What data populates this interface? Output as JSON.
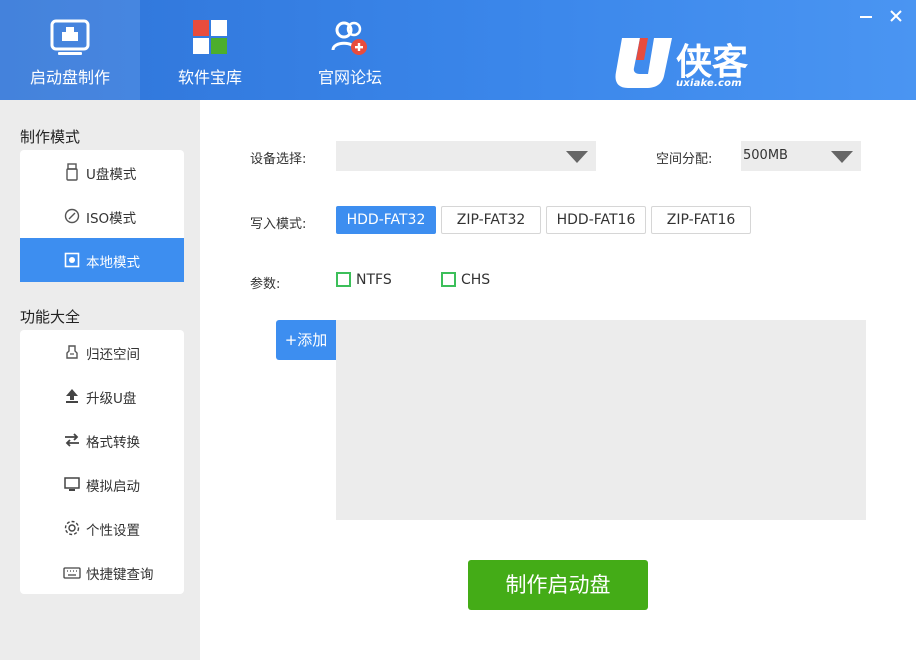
{
  "header": {
    "tabs": [
      {
        "label": "启动盘制作",
        "icon": "monitor-usb-icon",
        "active": true
      },
      {
        "label": "软件宝库",
        "icon": "app-grid-icon",
        "active": false
      },
      {
        "label": "官网论坛",
        "icon": "users-forum-icon",
        "active": false
      }
    ],
    "logo": {
      "brand": "U侠客",
      "url": "uxiake.com"
    },
    "window_controls": {
      "minimize": "minimize-icon",
      "close": "close-icon"
    }
  },
  "sidebar": {
    "make_mode_title": "制作模式",
    "make_modes": [
      {
        "label": "U盘模式",
        "icon": "usb-drive-icon",
        "active": false
      },
      {
        "label": "ISO模式",
        "icon": "disc-icon",
        "active": false
      },
      {
        "label": "本地模式",
        "icon": "local-disk-icon",
        "active": true
      }
    ],
    "functions_title": "功能大全",
    "functions": [
      {
        "label": "归还空间",
        "icon": "eraser-icon"
      },
      {
        "label": "升级U盘",
        "icon": "upload-icon"
      },
      {
        "label": "格式转换",
        "icon": "swap-arrows-icon"
      },
      {
        "label": "模拟启动",
        "icon": "monitor-icon"
      },
      {
        "label": "个性设置",
        "icon": "gear-icon"
      },
      {
        "label": "快捷键查询",
        "icon": "keyboard-icon"
      }
    ]
  },
  "main": {
    "device_label": "设备选择:",
    "device_value": "",
    "space_label": "空间分配:",
    "space_value": "500MB",
    "write_mode_label": "写入模式:",
    "write_modes": [
      {
        "label": "HDD-FAT32",
        "active": true
      },
      {
        "label": "ZIP-FAT32",
        "active": false
      },
      {
        "label": "HDD-FAT16",
        "active": false
      },
      {
        "label": "ZIP-FAT16",
        "active": false
      }
    ],
    "params_label": "参数:",
    "params": [
      {
        "label": "NTFS",
        "checked": false
      },
      {
        "label": "CHS",
        "checked": false
      }
    ],
    "add_button": "+添加",
    "make_button": "制作启动盘"
  },
  "colors": {
    "header_blue": "#3a86ea",
    "accent_blue": "#3d8ef0",
    "make_green": "#44ac17",
    "checkbox_green": "#3cbf5a",
    "sidebar_bg": "#ececec"
  }
}
